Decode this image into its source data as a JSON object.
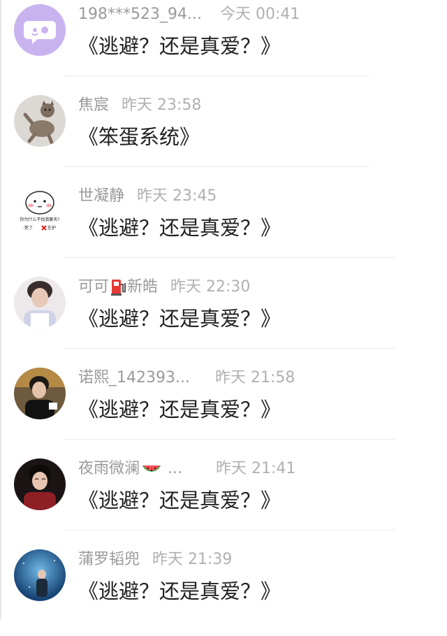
{
  "messages": [
    {
      "name": "198***523_94...",
      "time": "今天 00:41",
      "text": "《逃避？还是真爱？》",
      "avatar": "chat-bubble-logo"
    },
    {
      "name": "焦宸",
      "time": "昨天 23:58",
      "text": "《笨蛋系统》",
      "avatar": "cat"
    },
    {
      "name": "世凝静",
      "time": "昨天 23:45",
      "text": "《逃避？还是真爱？》",
      "avatar": "cartoon-dumpling",
      "avatar_caption": [
        "你为什么不找我聊天?",
        "·死了",
        "在护"
      ]
    },
    {
      "name": "可可",
      "name_after": "新皓",
      "name_icon": "fuel-pump-icon",
      "time": "昨天 22:30",
      "text": "《逃避？还是真爱？》",
      "avatar": "person-photo"
    },
    {
      "name": "诺熙_142393...",
      "time": "昨天 21:58",
      "text": "《逃避？还是真爱？》",
      "avatar": "person-photo"
    },
    {
      "name": "夜雨微澜",
      "name_icon": "watermelon-icon",
      "name_after": "...",
      "time": "昨天 21:41",
      "text": "《逃避？还是真爱？》",
      "avatar": "person-photo"
    },
    {
      "name": "蒲罗韬兜",
      "time": "昨天 21:39",
      "text": "《逃避？还是真爱？》",
      "avatar": "person-photo-blue"
    }
  ],
  "colors": {
    "name_text": "#9a9a9a",
    "time_text": "#b0b0b0",
    "message_text": "#222222",
    "divider": "#ebebeb",
    "logo_purple": "#c9b3ef"
  }
}
